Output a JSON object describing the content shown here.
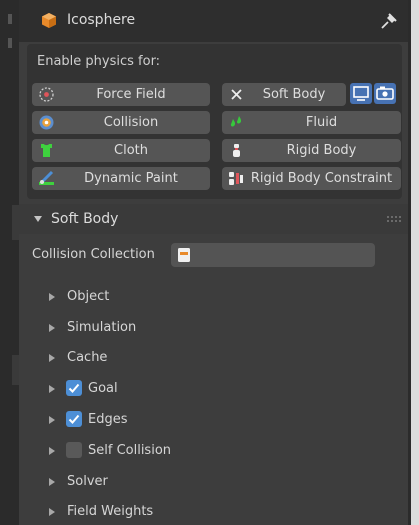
{
  "header": {
    "title": "Icosphere"
  },
  "enable_physics": {
    "label": "Enable physics for:",
    "buttons": [
      {
        "label": "Force Field",
        "icon": "force-field-icon"
      },
      {
        "label": "Soft Body",
        "icon": "close-x-icon",
        "state": "enabled"
      },
      {
        "label": "Collision",
        "icon": "collision-icon"
      },
      {
        "label": "Fluid",
        "icon": "fluid-drops-icon"
      },
      {
        "label": "Cloth",
        "icon": "cloth-shirt-icon"
      },
      {
        "label": "Rigid Body",
        "icon": "rigid-body-icon"
      },
      {
        "label": "Dynamic Paint",
        "icon": "brush-icon"
      },
      {
        "label": "Rigid Body Constraint",
        "icon": "rigid-constraint-icon"
      }
    ],
    "soft_body_toggles": [
      "monitor-icon",
      "camera-icon"
    ]
  },
  "soft_body_section": {
    "title": "Soft Body",
    "collision_collection": {
      "label": "Collision Collection",
      "value": ""
    },
    "subpanels": [
      {
        "label": "Object"
      },
      {
        "label": "Simulation"
      },
      {
        "label": "Cache"
      },
      {
        "label": "Goal",
        "checked": true
      },
      {
        "label": "Edges",
        "checked": true
      },
      {
        "label": "Self Collision",
        "checked": false
      },
      {
        "label": "Solver"
      },
      {
        "label": "Field Weights"
      }
    ]
  },
  "colors": {
    "panel_bg": "#3d3d3d",
    "header_bg": "#2e2e2e",
    "button_bg": "#555555",
    "accent_blue": "#4772b3",
    "checkbox_on": "#4d8fd6"
  }
}
